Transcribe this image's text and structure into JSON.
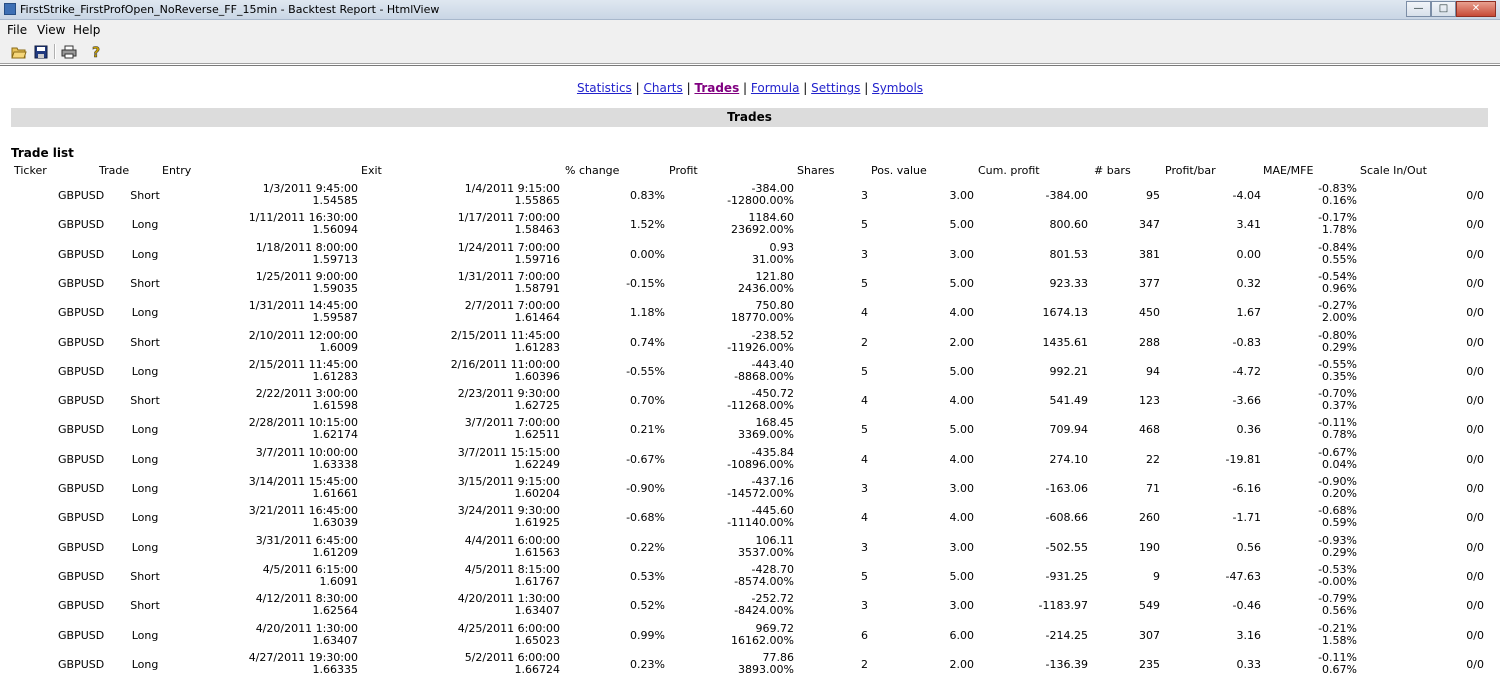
{
  "window": {
    "title": "FirstStrike_FirstProfOpen_NoReverse_FF_15min - Backtest Report - HtmlView"
  },
  "menu": [
    "File",
    "View",
    "Help"
  ],
  "toolbar": {
    "icons": [
      "open-folder-icon",
      "save-icon",
      "print-icon",
      "help-icon"
    ]
  },
  "nav": {
    "links": [
      "Statistics",
      "Charts",
      "Trades",
      "Formula",
      "Settings",
      "Symbols"
    ],
    "active": "Trades",
    "separator": "|"
  },
  "section_title": "Trades",
  "list_title": "Trade list",
  "columns": [
    "Ticker",
    "Trade",
    "Entry",
    "Exit",
    "% change",
    "Profit",
    "Shares",
    "Pos. value",
    "Cum. profit",
    "# bars",
    "Profit/bar",
    "MAE/MFE",
    "Scale In/Out"
  ],
  "trades": [
    {
      "ticker": "GBPUSD",
      "trade": "Short",
      "entry_date": "1/3/2011 9:45:00",
      "entry_price": "1.54585",
      "exit_date": "1/4/2011 9:15:00",
      "exit_price": "1.55865",
      "pct_change": "0.83%",
      "profit": "-384.00",
      "profit_pct": "-12800.00%",
      "shares": "3",
      "pos_value": "3.00",
      "cum_profit": "-384.00",
      "bars": "95",
      "profit_bar": "-4.04",
      "mae": "-0.83%",
      "mfe": "0.16%",
      "scale": "0/0"
    },
    {
      "ticker": "GBPUSD",
      "trade": "Long",
      "entry_date": "1/11/2011 16:30:00",
      "entry_price": "1.56094",
      "exit_date": "1/17/2011 7:00:00",
      "exit_price": "1.58463",
      "pct_change": "1.52%",
      "profit": "1184.60",
      "profit_pct": "23692.00%",
      "shares": "5",
      "pos_value": "5.00",
      "cum_profit": "800.60",
      "bars": "347",
      "profit_bar": "3.41",
      "mae": "-0.17%",
      "mfe": "1.78%",
      "scale": "0/0"
    },
    {
      "ticker": "GBPUSD",
      "trade": "Long",
      "entry_date": "1/18/2011 8:00:00",
      "entry_price": "1.59713",
      "exit_date": "1/24/2011 7:00:00",
      "exit_price": "1.59716",
      "pct_change": "0.00%",
      "profit": "0.93",
      "profit_pct": "31.00%",
      "shares": "3",
      "pos_value": "3.00",
      "cum_profit": "801.53",
      "bars": "381",
      "profit_bar": "0.00",
      "mae": "-0.84%",
      "mfe": "0.55%",
      "scale": "0/0"
    },
    {
      "ticker": "GBPUSD",
      "trade": "Short",
      "entry_date": "1/25/2011 9:00:00",
      "entry_price": "1.59035",
      "exit_date": "1/31/2011 7:00:00",
      "exit_price": "1.58791",
      "pct_change": "-0.15%",
      "profit": "121.80",
      "profit_pct": "2436.00%",
      "shares": "5",
      "pos_value": "5.00",
      "cum_profit": "923.33",
      "bars": "377",
      "profit_bar": "0.32",
      "mae": "-0.54%",
      "mfe": "0.96%",
      "scale": "0/0"
    },
    {
      "ticker": "GBPUSD",
      "trade": "Long",
      "entry_date": "1/31/2011 14:45:00",
      "entry_price": "1.59587",
      "exit_date": "2/7/2011 7:00:00",
      "exit_price": "1.61464",
      "pct_change": "1.18%",
      "profit": "750.80",
      "profit_pct": "18770.00%",
      "shares": "4",
      "pos_value": "4.00",
      "cum_profit": "1674.13",
      "bars": "450",
      "profit_bar": "1.67",
      "mae": "-0.27%",
      "mfe": "2.00%",
      "scale": "0/0"
    },
    {
      "ticker": "GBPUSD",
      "trade": "Short",
      "entry_date": "2/10/2011 12:00:00",
      "entry_price": "1.6009",
      "exit_date": "2/15/2011 11:45:00",
      "exit_price": "1.61283",
      "pct_change": "0.74%",
      "profit": "-238.52",
      "profit_pct": "-11926.00%",
      "shares": "2",
      "pos_value": "2.00",
      "cum_profit": "1435.61",
      "bars": "288",
      "profit_bar": "-0.83",
      "mae": "-0.80%",
      "mfe": "0.29%",
      "scale": "0/0"
    },
    {
      "ticker": "GBPUSD",
      "trade": "Long",
      "entry_date": "2/15/2011 11:45:00",
      "entry_price": "1.61283",
      "exit_date": "2/16/2011 11:00:00",
      "exit_price": "1.60396",
      "pct_change": "-0.55%",
      "profit": "-443.40",
      "profit_pct": "-8868.00%",
      "shares": "5",
      "pos_value": "5.00",
      "cum_profit": "992.21",
      "bars": "94",
      "profit_bar": "-4.72",
      "mae": "-0.55%",
      "mfe": "0.35%",
      "scale": "0/0"
    },
    {
      "ticker": "GBPUSD",
      "trade": "Short",
      "entry_date": "2/22/2011 3:00:00",
      "entry_price": "1.61598",
      "exit_date": "2/23/2011 9:30:00",
      "exit_price": "1.62725",
      "pct_change": "0.70%",
      "profit": "-450.72",
      "profit_pct": "-11268.00%",
      "shares": "4",
      "pos_value": "4.00",
      "cum_profit": "541.49",
      "bars": "123",
      "profit_bar": "-3.66",
      "mae": "-0.70%",
      "mfe": "0.37%",
      "scale": "0/0"
    },
    {
      "ticker": "GBPUSD",
      "trade": "Long",
      "entry_date": "2/28/2011 10:15:00",
      "entry_price": "1.62174",
      "exit_date": "3/7/2011 7:00:00",
      "exit_price": "1.62511",
      "pct_change": "0.21%",
      "profit": "168.45",
      "profit_pct": "3369.00%",
      "shares": "5",
      "pos_value": "5.00",
      "cum_profit": "709.94",
      "bars": "468",
      "profit_bar": "0.36",
      "mae": "-0.11%",
      "mfe": "0.78%",
      "scale": "0/0"
    },
    {
      "ticker": "GBPUSD",
      "trade": "Long",
      "entry_date": "3/7/2011 10:00:00",
      "entry_price": "1.63338",
      "exit_date": "3/7/2011 15:15:00",
      "exit_price": "1.62249",
      "pct_change": "-0.67%",
      "profit": "-435.84",
      "profit_pct": "-10896.00%",
      "shares": "4",
      "pos_value": "4.00",
      "cum_profit": "274.10",
      "bars": "22",
      "profit_bar": "-19.81",
      "mae": "-0.67%",
      "mfe": "0.04%",
      "scale": "0/0"
    },
    {
      "ticker": "GBPUSD",
      "trade": "Long",
      "entry_date": "3/14/2011 15:45:00",
      "entry_price": "1.61661",
      "exit_date": "3/15/2011 9:15:00",
      "exit_price": "1.60204",
      "pct_change": "-0.90%",
      "profit": "-437.16",
      "profit_pct": "-14572.00%",
      "shares": "3",
      "pos_value": "3.00",
      "cum_profit": "-163.06",
      "bars": "71",
      "profit_bar": "-6.16",
      "mae": "-0.90%",
      "mfe": "0.20%",
      "scale": "0/0"
    },
    {
      "ticker": "GBPUSD",
      "trade": "Long",
      "entry_date": "3/21/2011 16:45:00",
      "entry_price": "1.63039",
      "exit_date": "3/24/2011 9:30:00",
      "exit_price": "1.61925",
      "pct_change": "-0.68%",
      "profit": "-445.60",
      "profit_pct": "-11140.00%",
      "shares": "4",
      "pos_value": "4.00",
      "cum_profit": "-608.66",
      "bars": "260",
      "profit_bar": "-1.71",
      "mae": "-0.68%",
      "mfe": "0.59%",
      "scale": "0/0"
    },
    {
      "ticker": "GBPUSD",
      "trade": "Long",
      "entry_date": "3/31/2011 6:45:00",
      "entry_price": "1.61209",
      "exit_date": "4/4/2011 6:00:00",
      "exit_price": "1.61563",
      "pct_change": "0.22%",
      "profit": "106.11",
      "profit_pct": "3537.00%",
      "shares": "3",
      "pos_value": "3.00",
      "cum_profit": "-502.55",
      "bars": "190",
      "profit_bar": "0.56",
      "mae": "-0.93%",
      "mfe": "0.29%",
      "scale": "0/0"
    },
    {
      "ticker": "GBPUSD",
      "trade": "Short",
      "entry_date": "4/5/2011 6:15:00",
      "entry_price": "1.6091",
      "exit_date": "4/5/2011 8:15:00",
      "exit_price": "1.61767",
      "pct_change": "0.53%",
      "profit": "-428.70",
      "profit_pct": "-8574.00%",
      "shares": "5",
      "pos_value": "5.00",
      "cum_profit": "-931.25",
      "bars": "9",
      "profit_bar": "-47.63",
      "mae": "-0.53%",
      "mfe": "-0.00%",
      "scale": "0/0"
    },
    {
      "ticker": "GBPUSD",
      "trade": "Short",
      "entry_date": "4/12/2011 8:30:00",
      "entry_price": "1.62564",
      "exit_date": "4/20/2011 1:30:00",
      "exit_price": "1.63407",
      "pct_change": "0.52%",
      "profit": "-252.72",
      "profit_pct": "-8424.00%",
      "shares": "3",
      "pos_value": "3.00",
      "cum_profit": "-1183.97",
      "bars": "549",
      "profit_bar": "-0.46",
      "mae": "-0.79%",
      "mfe": "0.56%",
      "scale": "0/0"
    },
    {
      "ticker": "GBPUSD",
      "trade": "Long",
      "entry_date": "4/20/2011 1:30:00",
      "entry_price": "1.63407",
      "exit_date": "4/25/2011 6:00:00",
      "exit_price": "1.65023",
      "pct_change": "0.99%",
      "profit": "969.72",
      "profit_pct": "16162.00%",
      "shares": "6",
      "pos_value": "6.00",
      "cum_profit": "-214.25",
      "bars": "307",
      "profit_bar": "3.16",
      "mae": "-0.21%",
      "mfe": "1.58%",
      "scale": "0/0"
    },
    {
      "ticker": "GBPUSD",
      "trade": "Long",
      "entry_date": "4/27/2011 19:30:00",
      "entry_price": "1.66335",
      "exit_date": "5/2/2011 6:00:00",
      "exit_price": "1.66724",
      "pct_change": "0.23%",
      "profit": "77.86",
      "profit_pct": "3893.00%",
      "shares": "2",
      "pos_value": "2.00",
      "cum_profit": "-136.39",
      "bars": "235",
      "profit_bar": "0.33",
      "mae": "-0.11%",
      "mfe": "0.67%",
      "scale": "0/0"
    }
  ]
}
